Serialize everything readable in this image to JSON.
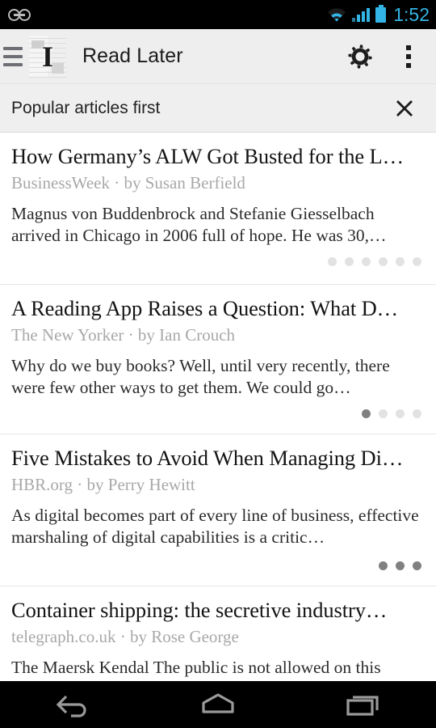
{
  "status_bar": {
    "time": "1:52",
    "accent_color": "#33b5e5",
    "left_icons": [
      {
        "name": "voicemail-icon"
      }
    ],
    "right_icons": [
      {
        "name": "wifi-icon"
      },
      {
        "name": "cellular-signal-icon"
      },
      {
        "name": "battery-icon"
      }
    ]
  },
  "toolbar": {
    "menu_icon": "hamburger-menu-icon",
    "app_icon_letter": "I",
    "app_icon_name": "instapaper-app-icon",
    "title": "Read Later",
    "settings_icon": "gear-icon",
    "overflow_icon": "overflow-menu-icon"
  },
  "banner": {
    "text": "Popular articles first",
    "close_icon": "close-icon"
  },
  "articles": [
    {
      "title": "How Germany’s ALW Got Busted for the L…",
      "meta": "BusinessWeek · by Susan Berfield",
      "excerpt": "Magnus von Buddenbrock and Stefanie Giesselbach arrived in Chicago in 2006 full of hope. He was 30,…",
      "length_dots_total": 6,
      "length_dots_filled": 0
    },
    {
      "title": "A Reading App Raises a Question: What D…",
      "meta": "The New Yorker · by Ian Crouch",
      "excerpt": "Why do we buy books? Well, until very recently, there were few other ways to get them. We could go…",
      "length_dots_total": 4,
      "length_dots_filled": 1
    },
    {
      "title": "Five Mistakes to Avoid When Managing Di…",
      "meta": "HBR.org · by Perry Hewitt",
      "excerpt": "As digital becomes part of every line of business, effective marshaling of digital capabilities is a critic…",
      "length_dots_total": 3,
      "length_dots_filled": 3
    },
    {
      "title": "Container shipping: the secretive industry…",
      "meta": "telegraph.co.uk · by Rose George",
      "excerpt": "The Maersk Kendal The public is not allowed on this",
      "length_dots_total": 0,
      "length_dots_filled": 0
    }
  ],
  "nav_bar": {
    "back": "back-button",
    "home": "home-button",
    "recents": "recents-button"
  }
}
